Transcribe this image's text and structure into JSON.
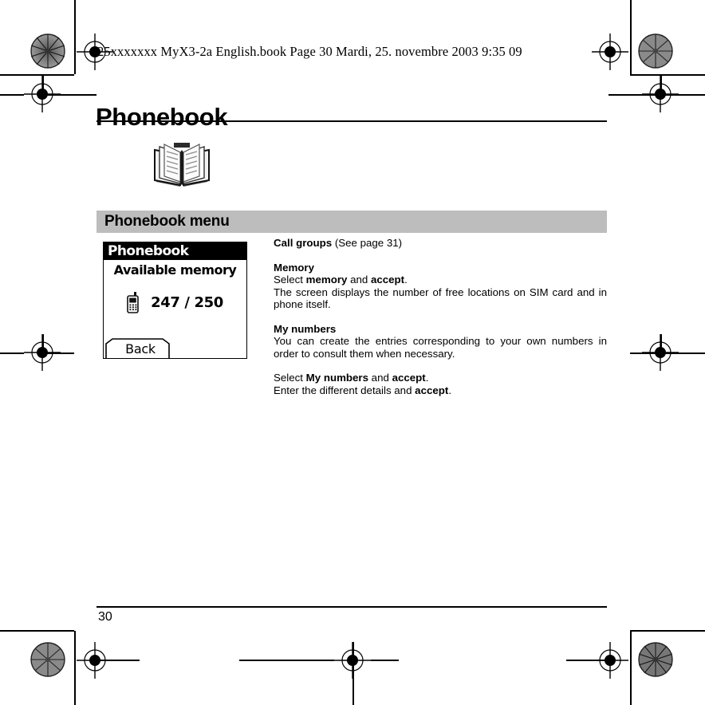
{
  "document": {
    "book_header": "25xxxxxxx MyX3-2a English.book  Page 30  Mardi, 25. novembre 2003  9:35 09",
    "title": "Phonebook",
    "page_number": "30",
    "book_icon_name": "open-book-icon"
  },
  "section": {
    "bar_label": "Phonebook menu",
    "bar_color": "#bdbdbd"
  },
  "phone_screen": {
    "title": "Phonebook",
    "subtitle": "Available memory",
    "memory_count": "247 / 250",
    "handset_icon_name": "mobile-handset-icon",
    "softkey_label": "Back"
  },
  "content": {
    "call_groups_heading": "Call groups",
    "call_groups_ref": " (See page 31)",
    "memory_heading": "Memory",
    "memory_select_prefix": "Select ",
    "memory_select_bold1": "memory",
    "memory_select_mid": " and ",
    "memory_select_bold2": "accept",
    "memory_select_suffix": ".",
    "memory_body": "The screen displays the number of free locations on SIM card and in phone itself.",
    "my_numbers_heading": "My numbers",
    "my_numbers_body": "You can create the entries corresponding to your own numbers in order to consult them when necessary.",
    "my_numbers_select_prefix": "Select ",
    "my_numbers_select_bold1": "My numbers",
    "my_numbers_select_mid": " and ",
    "my_numbers_select_bold2": "accept",
    "my_numbers_select_suffix": ".",
    "enter_details_prefix": "Enter the different details and ",
    "enter_details_bold": "accept",
    "enter_details_suffix": "."
  }
}
